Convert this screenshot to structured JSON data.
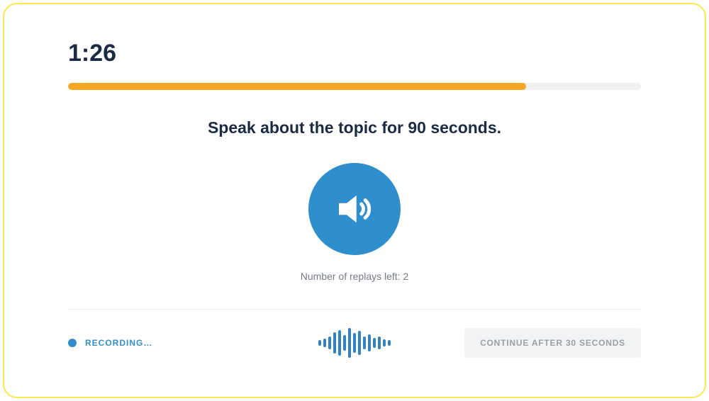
{
  "timer": "1:26",
  "progress": {
    "percent": 80
  },
  "instruction": "Speak about the topic for 90 seconds.",
  "replays_label": "Number of replays left: 2",
  "recording_label": "RECORDING…",
  "continue_label": "CONTINUE AFTER 30 SECONDS",
  "waveform_heights": [
    8,
    12,
    18,
    30,
    36,
    22,
    42,
    28,
    34,
    18,
    24,
    14,
    18,
    10,
    8
  ],
  "colors": {
    "accent_orange": "#f5a623",
    "accent_blue": "#2f8fcc",
    "text_dark": "#1b2b45",
    "border_yellow": "#fce94f"
  }
}
